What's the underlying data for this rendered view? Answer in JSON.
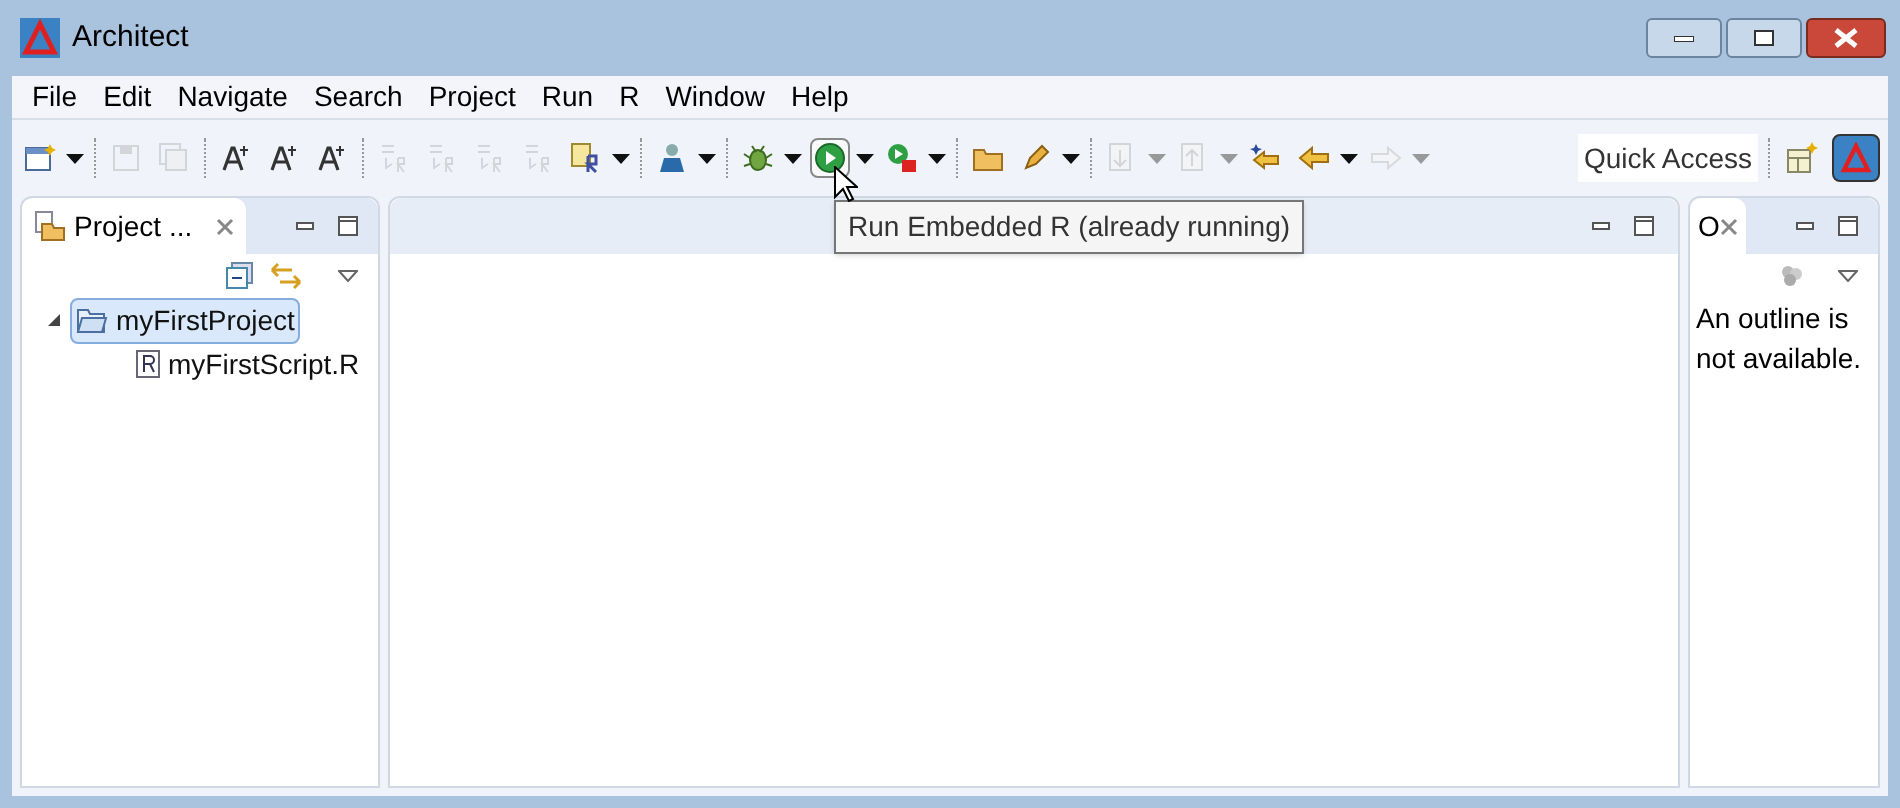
{
  "window": {
    "title": "Architect"
  },
  "menu": [
    {
      "label": "File"
    },
    {
      "label": "Edit"
    },
    {
      "label": "Navigate"
    },
    {
      "label": "Search"
    },
    {
      "label": "Project"
    },
    {
      "label": "Run"
    },
    {
      "label": "R"
    },
    {
      "label": "Window"
    },
    {
      "label": "Help"
    }
  ],
  "toolbar": [
    {
      "kind": "new",
      "disabled": false,
      "dropdown": true
    },
    {
      "kind": "sep"
    },
    {
      "kind": "save",
      "disabled": true
    },
    {
      "kind": "save-all",
      "disabled": true
    },
    {
      "kind": "sep"
    },
    {
      "kind": "font",
      "disabled": false
    },
    {
      "kind": "font",
      "disabled": false
    },
    {
      "kind": "font",
      "disabled": false
    },
    {
      "kind": "sep"
    },
    {
      "kind": "r-run",
      "disabled": true
    },
    {
      "kind": "r-run",
      "disabled": true
    },
    {
      "kind": "r-run",
      "disabled": true
    },
    {
      "kind": "r-run",
      "disabled": true
    },
    {
      "kind": "r-file",
      "disabled": false,
      "dropdown": true
    },
    {
      "kind": "sep"
    },
    {
      "kind": "person",
      "disabled": false,
      "dropdown": true
    },
    {
      "kind": "sep"
    },
    {
      "kind": "bug",
      "disabled": false,
      "dropdown": true
    },
    {
      "kind": "play",
      "disabled": false,
      "dropdown": true,
      "selected": true
    },
    {
      "kind": "play-stop",
      "disabled": false,
      "dropdown": true
    },
    {
      "kind": "sep"
    },
    {
      "kind": "folder",
      "disabled": false
    },
    {
      "kind": "pen",
      "disabled": false,
      "dropdown": true
    },
    {
      "kind": "sep"
    },
    {
      "kind": "down-doc",
      "disabled": true,
      "dropdown": true
    },
    {
      "kind": "up-doc",
      "disabled": true,
      "dropdown": true
    },
    {
      "kind": "back-star",
      "disabled": false
    },
    {
      "kind": "back",
      "disabled": false,
      "dropdown": true
    },
    {
      "kind": "forward",
      "disabled": true,
      "dropdown": true
    }
  ],
  "quick_access": {
    "placeholder": "Quick Access"
  },
  "tooltip": "Run Embedded R (already running)",
  "project_panel": {
    "tab": "Project ...",
    "tree": [
      {
        "label": "myFirstProject",
        "selected": true,
        "expanded": true,
        "children": [
          {
            "label": "myFirstScript.R",
            "selected": false
          }
        ]
      }
    ]
  },
  "outline_panel": {
    "tab": "O",
    "message": "An outline is not available."
  }
}
